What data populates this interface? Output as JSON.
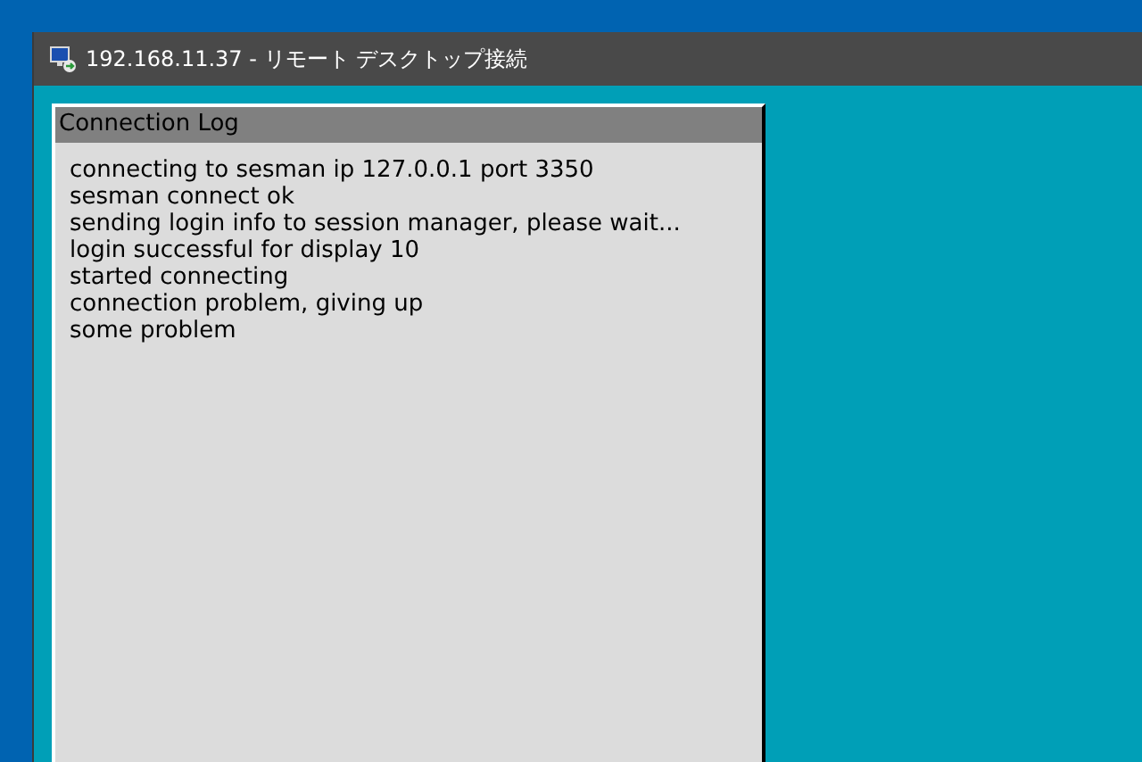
{
  "window": {
    "title": "192.168.11.37 - リモート デスクトップ接続"
  },
  "dialog": {
    "title": "Connection Log",
    "lines": [
      "connecting to sesman ip 127.0.0.1 port 3350",
      "sesman connect ok",
      "sending login info to session manager, please wait...",
      "login successful for display 10",
      "started connecting",
      "connection problem, giving up",
      "some problem"
    ]
  }
}
